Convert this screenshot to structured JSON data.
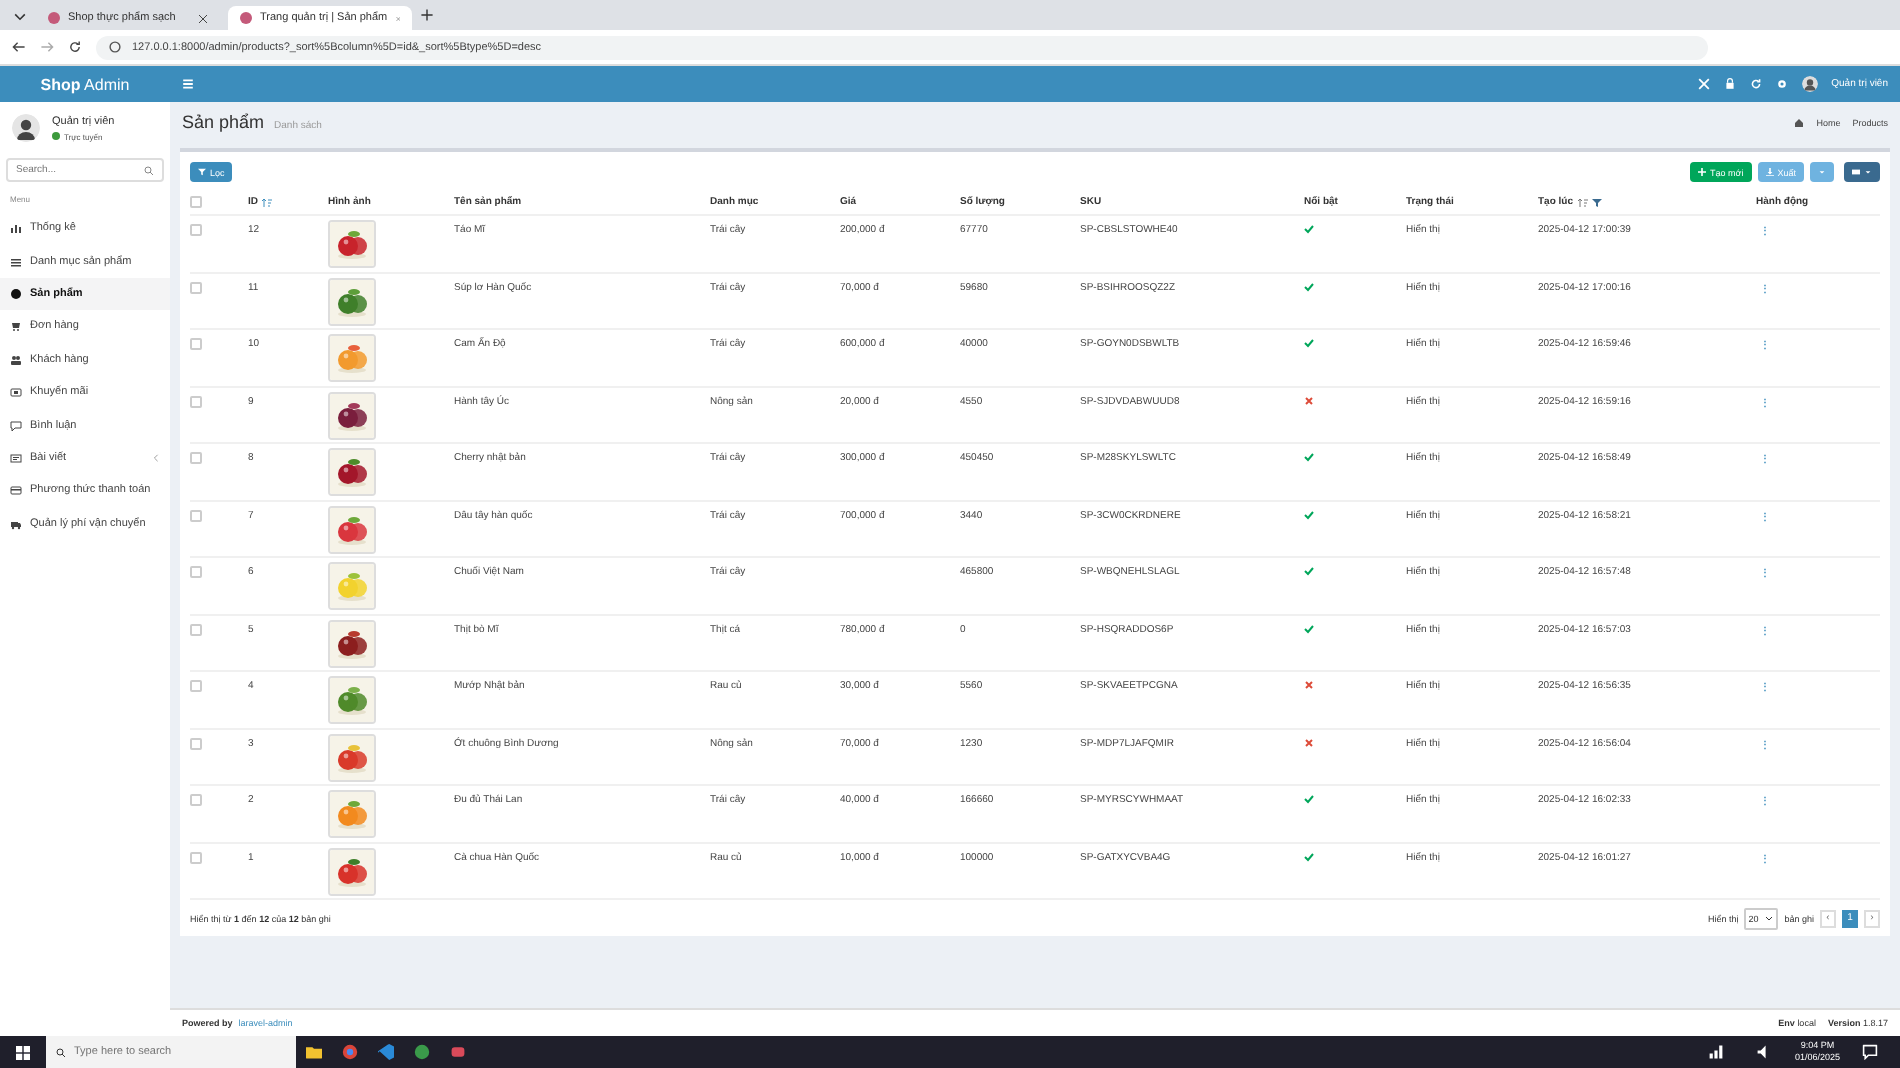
{
  "browser": {
    "tabs": [
      {
        "title": "Shop thực phẩm sạch",
        "selected": false
      },
      {
        "title": "Trang quản trị | Sản phẩm",
        "selected": true
      }
    ],
    "url": "127.0.0.1:8000/admin/products?_sort%5Bcolumn%5D=id&_sort%5Btype%5D=desc"
  },
  "header": {
    "brand_bold": "Shop",
    "brand_rest": "Admin",
    "user": "Quản trị viên"
  },
  "sidebar": {
    "user": {
      "name": "Quản trị viên",
      "status": "Trực tuyến"
    },
    "search": {
      "placeholder": "Search..."
    },
    "section": "Menu",
    "items": [
      {
        "label": "Thống kê",
        "selected": false
      },
      {
        "label": "Danh mục sản phẩm",
        "selected": false
      },
      {
        "label": "Sản phẩm",
        "selected": true
      },
      {
        "label": "Đơn hàng",
        "selected": false
      },
      {
        "label": "Khách hàng",
        "selected": false
      },
      {
        "label": "Khuyến mãi",
        "selected": false
      },
      {
        "label": "Bình luận",
        "selected": false
      },
      {
        "label": "Bài viết",
        "selected": false,
        "expandable": true
      },
      {
        "label": "Phương thức thanh toán",
        "selected": false
      },
      {
        "label": "Quản lý phí vận chuyển",
        "selected": false
      }
    ]
  },
  "page": {
    "title": "Sản phẩm",
    "subtitle": "Danh sách",
    "breadcrumb": [
      "Home",
      "Products"
    ]
  },
  "toolbar": {
    "filter": "Lọc",
    "create": "Tạo mới",
    "export": "Xuất"
  },
  "table": {
    "header_checked": false,
    "columns": [
      {
        "label": "ID",
        "sorted": true
      },
      {
        "label": "Hình ảnh"
      },
      {
        "label": "Tên sản phẩm"
      },
      {
        "label": "Danh mục"
      },
      {
        "label": "Giá"
      },
      {
        "label": "Số lượng"
      },
      {
        "label": "SKU"
      },
      {
        "label": "Nổi bật"
      },
      {
        "label": "Trạng thái"
      },
      {
        "label": "Tạo lúc",
        "sorted": false,
        "filter": true
      },
      {
        "label": "Hành động"
      }
    ],
    "rows": [
      {
        "checked": false,
        "id": "12",
        "name": "Táo Mĩ",
        "category": "Trái cây",
        "price": "200,000 đ",
        "quantity": "67770",
        "sku": "SP-CBSLSTOWHE40",
        "featured": true,
        "status": "Hiển thị",
        "created": "2025-04-12 17:00:39",
        "action": "⋮"
      },
      {
        "checked": false,
        "id": "11",
        "name": "Súp lơ Hàn Quốc",
        "category": "Trái cây",
        "price": "70,000 đ",
        "quantity": "59680",
        "sku": "SP-BSIHROOSQZ2Z",
        "featured": true,
        "status": "Hiển thị",
        "created": "2025-04-12 17:00:16",
        "action": "⋮"
      },
      {
        "checked": false,
        "id": "10",
        "name": "Cam Ấn Độ",
        "category": "Trái cây",
        "price": "600,000 đ",
        "quantity": "40000",
        "sku": "SP-GOYN0DSBWLTB",
        "featured": true,
        "status": "Hiển thị",
        "created": "2025-04-12 16:59:46",
        "action": "⋮"
      },
      {
        "checked": false,
        "id": "9",
        "name": "Hành tây Úc",
        "category": "Nông sản",
        "price": "20,000 đ",
        "quantity": "4550",
        "sku": "SP-SJDVDABWUUD8",
        "featured": false,
        "status": "Hiển thị",
        "created": "2025-04-12 16:59:16",
        "action": "⋮"
      },
      {
        "checked": false,
        "id": "8",
        "name": "Cherry nhật bản",
        "category": "Trái cây",
        "price": "300,000 đ",
        "quantity": "450450",
        "sku": "SP-M28SKYLSWLTC",
        "featured": true,
        "status": "Hiển thị",
        "created": "2025-04-12 16:58:49",
        "action": "⋮"
      },
      {
        "checked": false,
        "id": "7",
        "name": "Dâu tây hàn quốc",
        "category": "Trái cây",
        "price": "700,000 đ",
        "quantity": "3440",
        "sku": "SP-3CW0CKRDNERE",
        "featured": true,
        "status": "Hiển thị",
        "created": "2025-04-12 16:58:21",
        "action": "⋮"
      },
      {
        "checked": false,
        "id": "6",
        "name": "Chuối Việt Nam",
        "category": "Trái cây",
        "quantity": "465800",
        "sku": "SP-WBQNEHLSLAGL",
        "featured": true,
        "status": "Hiển thị",
        "created": "2025-04-12 16:57:48",
        "action": "⋮"
      },
      {
        "checked": false,
        "id": "5",
        "name": "Thịt bò Mĩ",
        "category": "Thịt cá",
        "price": "780,000 đ",
        "quantity": "0",
        "sku": "SP-HSQRADDOS6P",
        "featured": true,
        "status": "Hiển thị",
        "created": "2025-04-12 16:57:03",
        "action": "⋮"
      },
      {
        "checked": false,
        "id": "4",
        "name": "Mướp Nhật bản",
        "category": "Rau củ",
        "price": "30,000 đ",
        "quantity": "5560",
        "sku": "SP-SKVAEETPCGNA",
        "featured": false,
        "status": "Hiển thị",
        "created": "2025-04-12 16:56:35",
        "action": "⋮"
      },
      {
        "checked": false,
        "id": "3",
        "name": "Ớt chuông Bình Dương",
        "category": "Nông sản",
        "price": "70,000 đ",
        "quantity": "1230",
        "sku": "SP-MDP7LJAFQMIR",
        "featured": false,
        "status": "Hiển thị",
        "created": "2025-04-12 16:56:04",
        "action": "⋮"
      },
      {
        "checked": false,
        "id": "2",
        "name": "Đu đủ Thái Lan",
        "category": "Trái cây",
        "price": "40,000 đ",
        "quantity": "166660",
        "sku": "SP-MYRSCYWHMAAT",
        "featured": true,
        "status": "Hiển thị",
        "created": "2025-04-12 16:02:33",
        "action": "⋮"
      },
      {
        "checked": false,
        "id": "1",
        "name": "Cà chua Hàn Quốc",
        "category": "Rau củ",
        "price": "10,000 đ",
        "quantity": "100000",
        "sku": "SP-GATXYCVBA4G",
        "featured": true,
        "status": "Hiển thị",
        "created": "2025-04-12 16:01:27",
        "action": "⋮"
      }
    ]
  },
  "pager": {
    "summary": "Hiển thị từ **1** đến **12** của **12** bản ghi",
    "per_page_label": "Hiển thị",
    "per_page": "20",
    "per_page_suffix": "bản ghi",
    "prev": "‹",
    "next": "›",
    "pages": [
      {
        "label": "1",
        "selected": true
      }
    ]
  },
  "footer": {
    "powered_by": "Powered by",
    "link": "laravel-admin",
    "env_label": "Env",
    "env": "local",
    "version_label": "Version",
    "version": "1.8.17"
  },
  "taskbar": {
    "search_placeholder": "Type here to search",
    "time": "9:04 PM",
    "date": "01/06/2025"
  }
}
